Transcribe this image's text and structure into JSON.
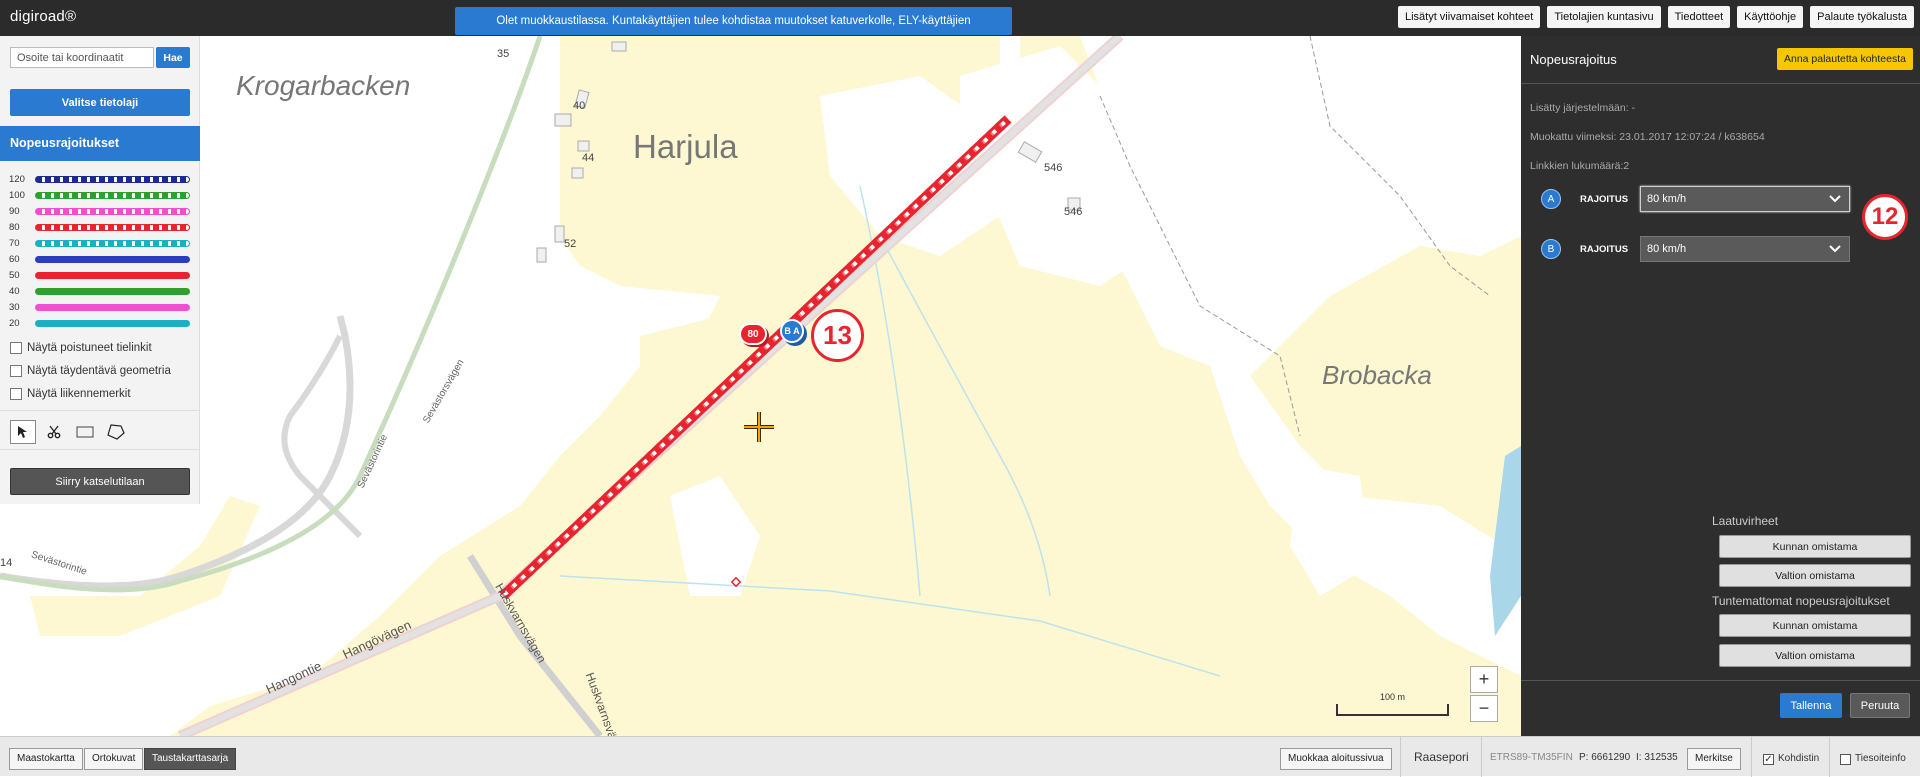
{
  "app": {
    "logo": "digiroad®"
  },
  "notice": "Olet muokkaustilassa. Kuntakäyttäjien tulee kohdistaa muutokset katuverkolle, ELY-käyttäjien maantieverkolle.",
  "top_links": [
    "Lisätyt viivamaiset kohteet",
    "Tietolajien kuntasivu",
    "Tiedotteet",
    "Käyttöohje",
    "Palaute työkalusta"
  ],
  "left": {
    "search_placeholder": "Osoite tai koordinaatit",
    "search_button": "Hae",
    "select_layer_button": "Valitse tietolaji",
    "layer_title": "Nopeusrajoitukset",
    "legend": [
      {
        "label": "120",
        "color": "#1d2b8f",
        "pattern": "dashed"
      },
      {
        "label": "100",
        "color": "#2ea02e",
        "pattern": "dashed"
      },
      {
        "label": "90",
        "color": "#f24fcf",
        "pattern": "dashed"
      },
      {
        "label": "80",
        "color": "#e8242e",
        "pattern": "dashed"
      },
      {
        "label": "70",
        "color": "#19b0c2",
        "pattern": "dashed"
      },
      {
        "label": "60",
        "color": "#2a3ec2",
        "pattern": "solid"
      },
      {
        "label": "50",
        "color": "#e8242e",
        "pattern": "solid"
      },
      {
        "label": "40",
        "color": "#2ea02e",
        "pattern": "solid"
      },
      {
        "label": "30",
        "color": "#f24fcf",
        "pattern": "solid"
      },
      {
        "label": "20",
        "color": "#19b0c2",
        "pattern": "solid"
      }
    ],
    "checkboxes": [
      "Näytä poistuneet tielinkit",
      "Näytä täydentävä geometria",
      "Näytä liikennemerkit"
    ],
    "tools": [
      "select-tool-icon",
      "cut-tool-icon",
      "rectangle-tool-icon",
      "polygon-tool-icon"
    ],
    "view_mode_button": "Siirry katselutilaan"
  },
  "map": {
    "place_labels": [
      "Krogarbacken",
      "Harjula",
      "Brobacka"
    ],
    "numbers": [
      "35",
      "40",
      "44",
      "52",
      "546",
      "546",
      "14"
    ],
    "road_labels": [
      "Sevästorintie",
      "Sevästorintie",
      "Sevästorsvägen",
      "Hangontie",
      "Hangövägen",
      "Huskvarnsvägen",
      "Huskvarnsvägen"
    ],
    "speed_sign": "80",
    "marker_text": "B A",
    "annotation_13": "13",
    "annotation_12": "12",
    "scale": "100 m",
    "zoom_in": "+",
    "zoom_out": "−"
  },
  "right": {
    "title": "Nopeusrajoitus",
    "feedback_button": "Anna palautetta kohteesta",
    "added": "Lisätty järjestelmään: -",
    "modified": "Muokattu viimeksi: 23.01.2017 12:07:24 / k638654",
    "links_count": "Linkkien lukumäärä:2",
    "limits": [
      {
        "side": "A",
        "label": "RAJOITUS",
        "value": "80 km/h"
      },
      {
        "side": "B",
        "label": "RAJOITUS",
        "value": "80 km/h"
      }
    ],
    "quality_heading": "Laatuvirheet",
    "quality_buttons": [
      "Kunnan omistama",
      "Valtion omistama"
    ],
    "unknown_heading": "Tuntemattomat nopeusrajoitukset",
    "unknown_buttons": [
      "Kunnan omistama",
      "Valtion omistama"
    ],
    "save": "Tallenna",
    "cancel": "Peruuta"
  },
  "bottom": {
    "base_layers": [
      "Maastokartta",
      "Ortokuvat",
      "Taustakarttasarja"
    ],
    "edit_start_button": "Muokkaa aloitussivua",
    "municipality": "Raasepori",
    "crs": "ETRS89-TM35FIN",
    "coord_p": "P: 6661290",
    "coord_i": "I: 312535",
    "mark_button": "Merkitse",
    "cursor_check": "Kohdistin",
    "tileinfo_check": "Tiesoiteinfo"
  }
}
